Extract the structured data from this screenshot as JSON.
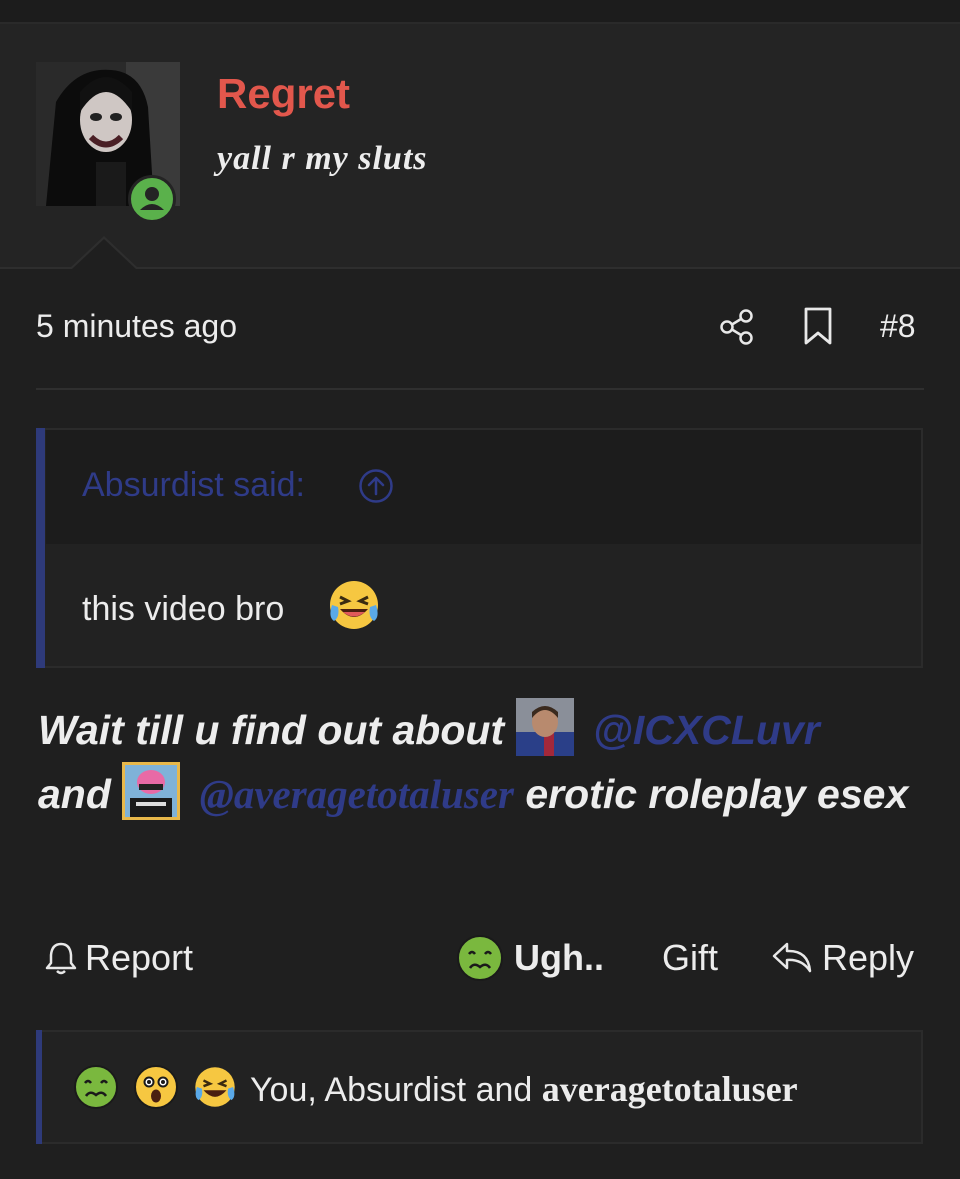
{
  "post": {
    "username": "Regret",
    "user_title": "yall r my sluts",
    "timestamp": "5 minutes ago",
    "post_number": "#8",
    "quote": {
      "author_label": "Absurdist said:",
      "text": "this video bro"
    },
    "message": {
      "part1": "Wait till u find out about",
      "mention1": "@ICXCLuvr",
      "part2": "and",
      "mention2": "@averagetotaluser",
      "part3": "erotic roleplay esex"
    },
    "actions": {
      "report": "Report",
      "reaction": "Ugh..",
      "gift": "Gift",
      "reply": "Reply"
    },
    "reactions": {
      "prefix": "You, Absurdist and ",
      "last_user": "averagetotaluser"
    }
  },
  "icons": [
    "share-icon",
    "bookmark-icon",
    "arrow-up-circle-icon",
    "bell-icon",
    "reply-arrow-icon",
    "nauseated-emoji",
    "astonished-emoji",
    "laughing-crying-emoji"
  ],
  "colors": {
    "background": "#1f1f1f",
    "username": "#e2574c",
    "mention": "#2f3b88",
    "online": "#5ab14b"
  }
}
